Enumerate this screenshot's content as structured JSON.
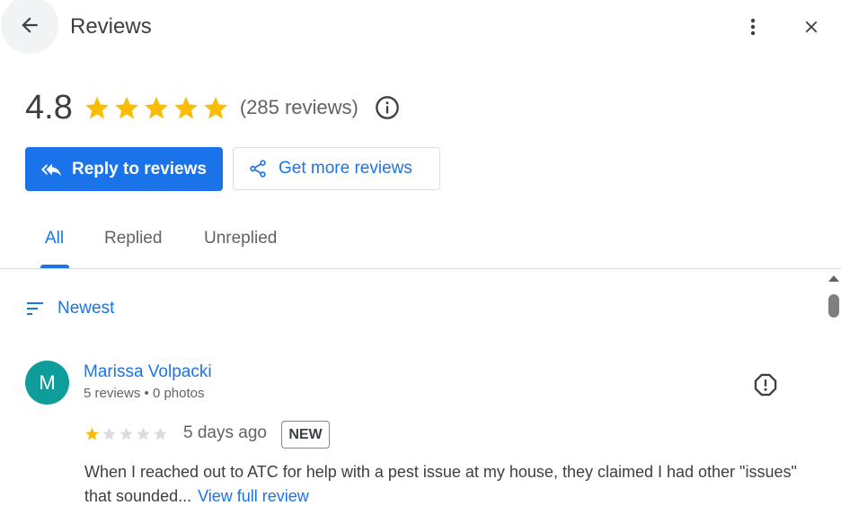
{
  "header": {
    "title": "Reviews",
    "icons": {
      "back": "arrow-back-icon",
      "more": "more-vert-icon",
      "close": "close-icon"
    }
  },
  "summary": {
    "rating": "4.8",
    "stars_filled": 5,
    "review_count": "(285 reviews)",
    "star_color": "#fbbc04"
  },
  "actions": {
    "reply_label": "Reply to reviews",
    "get_more_label": "Get more reviews"
  },
  "tabs": [
    {
      "label": "All",
      "active": true
    },
    {
      "label": "Replied",
      "active": false
    },
    {
      "label": "Unreplied",
      "active": false
    }
  ],
  "sort": {
    "label": "Newest"
  },
  "reviews": [
    {
      "avatar_initial": "M",
      "avatar_color": "#0f9d9b",
      "name": "Marissa Volpacki",
      "meta": "5 reviews • 0 photos",
      "stars": 1,
      "date": "5 days ago",
      "badge": "NEW",
      "text": "When I reached out to ATC for help with a pest issue at my house, they claimed I had other \"issues\" that sounded...",
      "view_full": "View full review"
    }
  ],
  "colors": {
    "accent": "#1a73e8",
    "text": "#3c4043",
    "muted": "#5f6368"
  }
}
